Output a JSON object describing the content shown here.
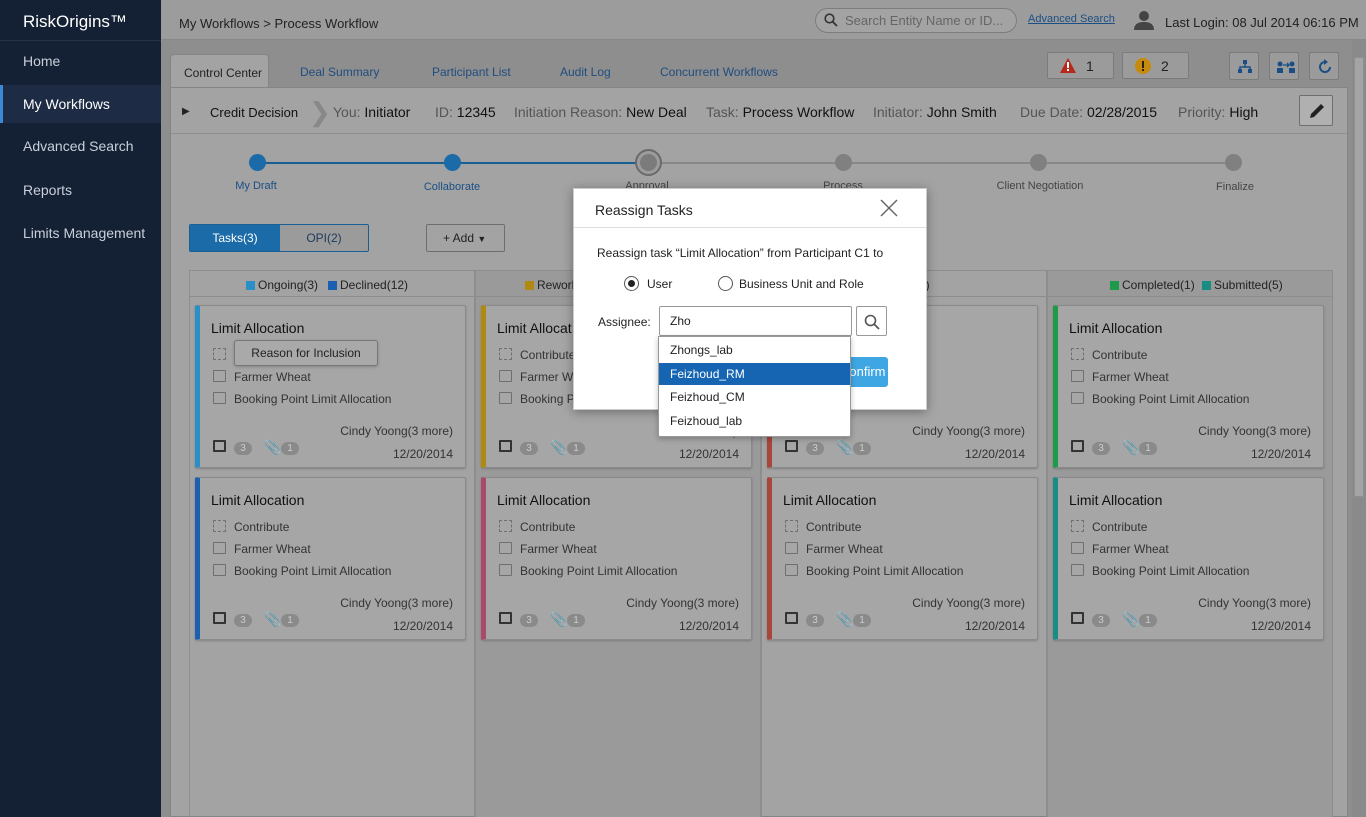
{
  "app": {
    "brand": "RiskOrigins™"
  },
  "sidebar": {
    "items": [
      {
        "label": "Home"
      },
      {
        "label": "My Workflows",
        "active": true
      },
      {
        "label": "Advanced Search"
      },
      {
        "label": "Reports"
      },
      {
        "label": "Limits Management"
      }
    ]
  },
  "topbar": {
    "breadcrumb": "My Workflows > Process Workflow",
    "search_placeholder": "Search Entity Name or ID...",
    "advanced_search": "Advanced Search",
    "last_login": "Last Login: 08 Jul 2014 06:16 PM"
  },
  "tabs": [
    "Control Center",
    "Deal Summary",
    "Participant List",
    "Audit Log",
    "Concurrent Workflows"
  ],
  "counters": {
    "errors": "1",
    "warnings": "2"
  },
  "credit_bar": {
    "title": "Credit Decision",
    "you_label": "You:",
    "you": "Initiator",
    "id_label": "ID:",
    "id": "12345",
    "reason_label": "Initiation Reason:",
    "reason": "New Deal",
    "task_label": "Task:",
    "task": "Process Workflow",
    "initiator_label": "Initiator:",
    "initiator": "John Smith",
    "due_label": "Due Date:",
    "due": "02/28/2015",
    "priority_label": "Priority:",
    "priority": "High"
  },
  "stages": [
    "My Draft",
    "Collaborate",
    "Approval",
    "Process",
    "Client Negotiation",
    "Finalize"
  ],
  "toggle": {
    "tasks": "Tasks(3)",
    "opi": "OPI(2)"
  },
  "add_label": "+ Add",
  "columns": [
    {
      "legend": [
        {
          "label": "Ongoing(3)",
          "color": "#2b8fc7"
        },
        {
          "label": "Declined(12)",
          "color": "#1b5fb0"
        }
      ]
    },
    {
      "legend": [
        {
          "label": "Rework",
          "color": "#b08a10"
        }
      ]
    },
    {
      "legend": [
        {
          "label": "2)",
          "color": ""
        }
      ]
    },
    {
      "legend": [
        {
          "label": "Completed(1)",
          "color": "#1f9a4a"
        },
        {
          "label": "Submitted(5)",
          "color": "#1b8c84"
        }
      ]
    }
  ],
  "cards": [
    {
      "title": "Limit Allocation",
      "role": "",
      "party": "Farmer Wheat",
      "booking": "Booking Point Limit Allocation",
      "who": "Cindy Yoong(3 more)",
      "date": "12/20/2014",
      "notes": "3",
      "att": "1",
      "color": "#2b8fc7"
    },
    {
      "title": "Limit Allocat",
      "role": "Contribute",
      "party": "Farmer W",
      "booking": "Booking P",
      "who": "Cindy",
      "date": "12/20/2014",
      "notes": "3",
      "att": "1",
      "color": "#b08a10"
    },
    {
      "title": "",
      "role": "",
      "party": "",
      "booking": "ocation",
      "who": "Cindy Yoong(3 more)",
      "date": "12/20/2014",
      "notes": "3",
      "att": "1",
      "color": "#a8463c"
    },
    {
      "title": "Limit Allocation",
      "role": "Contribute",
      "party": "Farmer Wheat",
      "booking": "Booking Point Limit Allocation",
      "who": "Cindy Yoong(3 more)",
      "date": "12/20/2014",
      "notes": "3",
      "att": "1",
      "color": "#1f9a4a"
    },
    {
      "title": "Limit Allocation",
      "role": "Contribute",
      "party": "Farmer Wheat",
      "booking": "Booking Point Limit Allocation",
      "who": "Cindy Yoong(3 more)",
      "date": "12/20/2014",
      "notes": "3",
      "att": "1",
      "color": "#1b5fb0"
    },
    {
      "title": "Limit Allocation",
      "role": "Contribute",
      "party": "Farmer Wheat",
      "booking": "Booking Point Limit Allocation",
      "who": "Cindy Yoong(3 more)",
      "date": "12/20/2014",
      "notes": "3",
      "att": "1",
      "color": "#a84a6a"
    },
    {
      "title": "Limit Allocation",
      "role": "Contribute",
      "party": "Farmer Wheat",
      "booking": "Booking Point Limit Allocation",
      "who": "Cindy Yoong(3 more)",
      "date": "12/20/2014",
      "notes": "3",
      "att": "1",
      "color": "#a8463c"
    },
    {
      "title": "Limit Allocation",
      "role": "Contribute",
      "party": "Farmer Wheat",
      "booking": "Booking Point Limit Allocation",
      "who": "Cindy Yoong(3 more)",
      "date": "12/20/2014",
      "notes": "3",
      "att": "1",
      "color": "#1b8c84"
    }
  ],
  "tooltip": "Reason for Inclusion",
  "modal": {
    "title": "Reassign Tasks",
    "text": "Reassign task “Limit Allocation” from Participant C1 to",
    "option_user": "User",
    "option_bu": "Business Unit and Role",
    "assignee_label": "Assignee:",
    "assignee_value": "Zho",
    "confirm": "Confirm",
    "suggestions": [
      "Zhongs_lab",
      "Feizhoud_RM",
      "Feizhoud_CM",
      "Feizhoud_lab"
    ],
    "selected_suggestion": "Feizhoud_RM"
  }
}
